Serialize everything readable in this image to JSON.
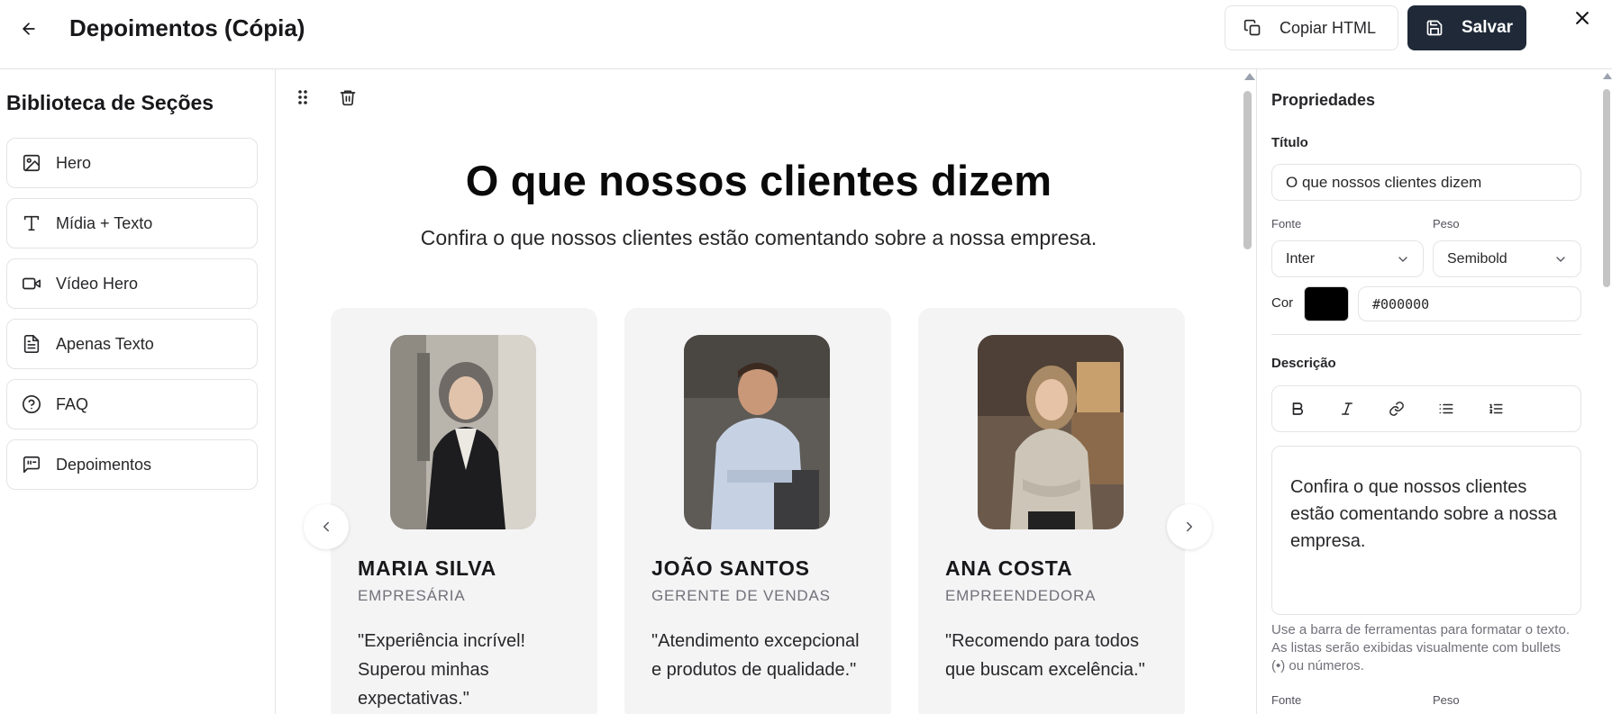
{
  "header": {
    "title": "Depoimentos (Cópia)",
    "copy_label": "Copiar HTML",
    "save_label": "Salvar"
  },
  "sidebar": {
    "title": "Biblioteca de Seções",
    "items": [
      {
        "label": "Hero",
        "icon": "image-icon"
      },
      {
        "label": "Mídia + Texto",
        "icon": "text-type-icon"
      },
      {
        "label": "Vídeo Hero",
        "icon": "video-icon"
      },
      {
        "label": "Apenas Texto",
        "icon": "file-text-icon"
      },
      {
        "label": "FAQ",
        "icon": "help-circle-icon"
      },
      {
        "label": "Depoimentos",
        "icon": "message-quote-icon"
      }
    ]
  },
  "canvas": {
    "title": "O que nossos clientes dizem",
    "description": "Confira o que nossos clientes estão comentando sobre a nossa empresa.",
    "testimonials": [
      {
        "name": "MARIA SILVA",
        "role": "EMPRESÁRIA",
        "quote": "\"Experiência incrível! Superou minhas expectativas.\""
      },
      {
        "name": "JOÃO SANTOS",
        "role": "GERENTE DE VENDAS",
        "quote": "\"Atendimento excepcional e produtos de qualidade.\""
      },
      {
        "name": "ANA COSTA",
        "role": "EMPREENDEDORA",
        "quote": "\"Recomendo para todos que buscam excelência.\""
      }
    ]
  },
  "props": {
    "title": "Propriedades",
    "titulo_label": "Título",
    "titulo_value": "O que nossos clientes dizem",
    "fonte_label": "Fonte",
    "fonte_value": "Inter",
    "peso_label": "Peso",
    "peso_value": "Semibold",
    "cor_label": "Cor",
    "cor_value": "#000000",
    "descricao_label": "Descrição",
    "descricao_value": "Confira o que nossos clientes estão comentando sobre a nossa empresa.",
    "hint": "Use a barra de ferramentas para formatar o texto. As listas serão exibidas visualmente com bullets (•) ou números.",
    "fonte_label_2": "Fonte",
    "peso_label_2": "Peso"
  },
  "colors": {
    "accent_dark": "#1f2937",
    "border": "#e4e4e7",
    "card_bg": "#f4f4f5"
  }
}
